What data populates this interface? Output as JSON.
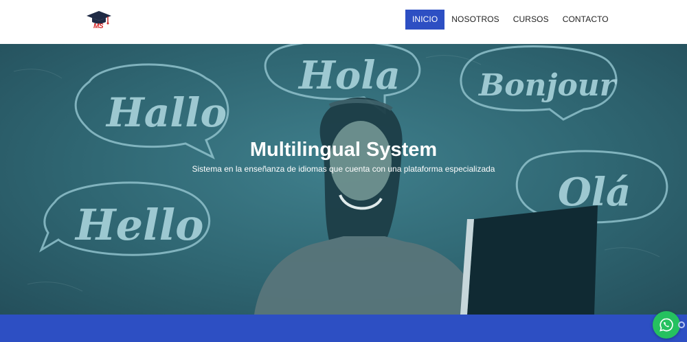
{
  "brand": {
    "logo_text": "MS"
  },
  "nav": {
    "items": [
      {
        "label": "INICIO",
        "active": true
      },
      {
        "label": "NOSOTROS",
        "active": false
      },
      {
        "label": "CURSOS",
        "active": false
      },
      {
        "label": "CONTACTO",
        "active": false
      }
    ]
  },
  "hero": {
    "title": "Multilingual System",
    "subtitle": "Sistema en la enseñanza de idiomas que cuenta con una plataforma especializada",
    "bubbles": [
      "Hallo",
      "Hola",
      "Bonjour",
      "Hello",
      "Olá"
    ]
  },
  "floating": {
    "whatsapp_icon": "whatsapp-icon"
  },
  "colors": {
    "accent": "#2d4fc3",
    "whatsapp": "#25c15f",
    "overlay": "#2f6672"
  }
}
